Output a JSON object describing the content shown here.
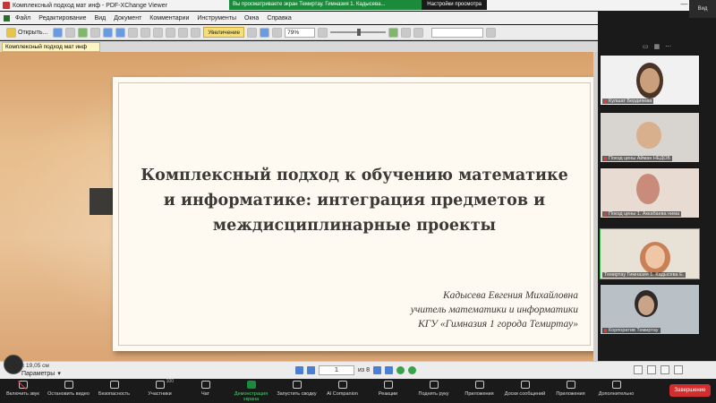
{
  "window": {
    "title": "Комплексный подход мат инф - PDF-XChange Viewer",
    "controls": [
      "—",
      "□",
      "✕"
    ]
  },
  "share_banner": {
    "text": "Вы просматриваете экран Темиртау. Гимназия 1. Кадысева...",
    "options": "Настройки просмотра",
    "feed": "Вид"
  },
  "menu": [
    "Файл",
    "Редактирование",
    "Вид",
    "Документ",
    "Комментарии",
    "Инструменты",
    "Окна",
    "Справка"
  ],
  "toolbar": {
    "open_label": "Открыть...",
    "zoom_tool": "Увеличение",
    "zoom_value": "79%"
  },
  "doc_tab": "Комплексный подход мат инф",
  "slide": {
    "title_lines": [
      "Комплексный подход к обучению математике",
      "и информатике: интеграция предметов и",
      "междисциплинарные проекты"
    ],
    "author_lines": [
      "Кадысева Евгения Михайловна",
      "учитель математики и информатики",
      "КГУ «Гимназия 1 города Темиртау»"
    ]
  },
  "status": {
    "coord": "x 19,05 см",
    "params": "Параметры",
    "page_current": "1",
    "page_of": "из 8"
  },
  "participants_header": "",
  "participants": [
    {
      "name": "Кулшат Бердияева",
      "muted": true
    },
    {
      "name": "Поезд цены Айман НЕДОБ",
      "muted": true
    },
    {
      "name": "Поезд цены 1. Аккабаева нима",
      "muted": true
    },
    {
      "name": "Темиртау Гимназия 1. Кадысева Е.",
      "muted": false
    },
    {
      "name": "Корпоратив Темиртау",
      "muted": true
    }
  ],
  "controls": [
    {
      "label": "Включить звук",
      "count": ""
    },
    {
      "label": "Остановить видео",
      "count": ""
    },
    {
      "label": "Безопасность",
      "count": ""
    },
    {
      "label": "Участники",
      "count": "100"
    },
    {
      "label": "Чат",
      "count": ""
    },
    {
      "label": "Демонстрация экрана",
      "count": ""
    },
    {
      "label": "Запустить сводку",
      "count": ""
    },
    {
      "label": "AI Companion",
      "count": ""
    },
    {
      "label": "Реакции",
      "count": ""
    },
    {
      "label": "Поднять руку",
      "count": ""
    },
    {
      "label": "Приложения",
      "count": ""
    },
    {
      "label": "Доски сообщений",
      "count": ""
    },
    {
      "label": "Приложения",
      "count": ""
    },
    {
      "label": "Дополнительно",
      "count": ""
    }
  ],
  "end_label": "Завершение"
}
